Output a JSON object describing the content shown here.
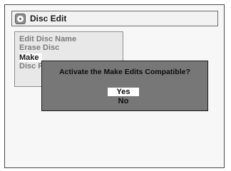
{
  "title_bar": {
    "icon": "disc-icon",
    "title": "Disc Edit"
  },
  "menu": {
    "items": [
      {
        "label": "Edit Disc Name"
      },
      {
        "label": "Erase Disc"
      },
      {
        "label": "Make"
      },
      {
        "label": "Disc F"
      }
    ]
  },
  "dialog": {
    "question": "Activate the Make Edits Compatible?",
    "yes_label": "Yes",
    "no_label": "No"
  },
  "colors": {
    "dialog_bg": "#777777",
    "selected_bg": "#ffffff",
    "menu_disabled_text": "#7c7c7c"
  }
}
